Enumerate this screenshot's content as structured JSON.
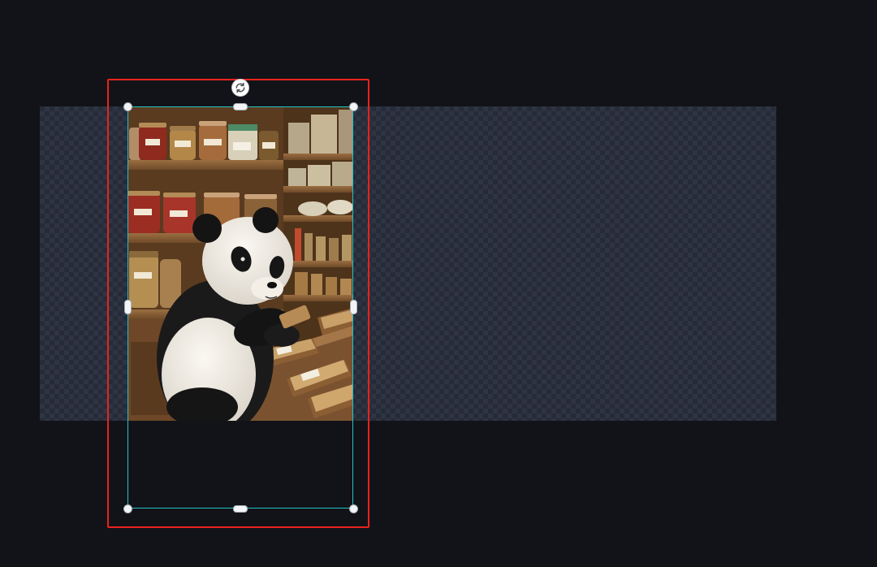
{
  "editor": {
    "canvas": {
      "background": "transparent-checkerboard"
    },
    "layer": {
      "type": "image",
      "subject": "panda",
      "selected": true
    },
    "selection": {
      "outline_color": "#e8231d",
      "transform_color": "#23c3c6"
    },
    "icons": {
      "rotate": "rotate-icon"
    }
  }
}
